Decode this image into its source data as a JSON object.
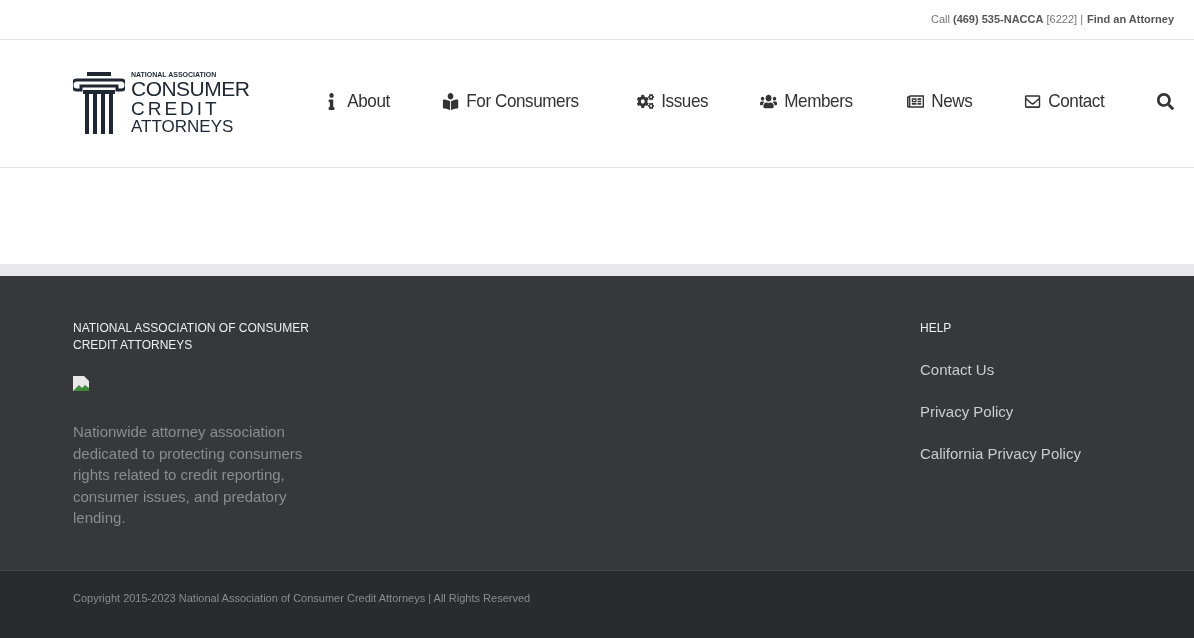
{
  "top_bar": {
    "contact": "Call **(469) 535-NACCA** [6222] |",
    "link": "Find an Attorney"
  },
  "logo": {
    "line_1": "NATIONAL ASSOCIATION",
    "line_2": "CONSUMER",
    "line_3": "CREDIT",
    "line_4": "ATTORNEYS"
  },
  "nav": [
    {
      "label": "About"
    },
    {
      "label": "For Consumers"
    },
    {
      "label": "Issues"
    },
    {
      "label": "Members"
    },
    {
      "label": "News"
    },
    {
      "label": "Contact"
    }
  ],
  "footer": {
    "about": {
      "title": "NATIONAL ASSOCIATION OF CONSUMER CREDIT ATTORNEYS",
      "text": "Nationwide attorney association dedicated to protecting consumers rights related to credit reporting, consumer issues, and predatory lending."
    },
    "help": {
      "title": "HELP",
      "links": [
        "Contact Us",
        "Privacy Policy",
        "California Privacy Policy"
      ]
    }
  },
  "copyright": "Copyright 2015-2023 National Association of Consumer Credit Attorneys | All Rights Reserved"
}
